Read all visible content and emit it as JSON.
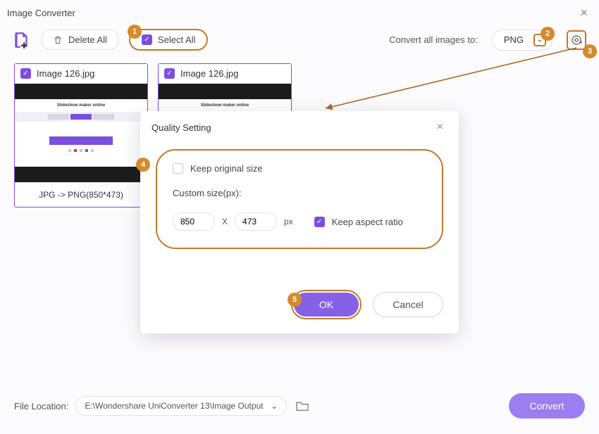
{
  "window": {
    "title": "Image Converter"
  },
  "toolbar": {
    "delete_all_label": "Delete All",
    "select_all_label": "Select All",
    "convert_to_label": "Convert all images to:",
    "format_value": "PNG"
  },
  "images": [
    {
      "name": "Image 126.jpg",
      "thumb_title": "Slideshow maker online",
      "conversion": "JPG -> PNG(850*473)"
    },
    {
      "name": "Image 126.jpg",
      "thumb_title": "Slideshow maker online",
      "conversion": ""
    }
  ],
  "dialog": {
    "title": "Quality Setting",
    "keep_original_label": "Keep original size",
    "custom_size_label": "Custom size(px):",
    "width": "850",
    "height": "473",
    "px_label": "px",
    "keep_aspect_label": "Keep aspect ratio",
    "ok_label": "OK",
    "cancel_label": "Cancel"
  },
  "badges": {
    "b1": "1",
    "b2": "2",
    "b3": "3",
    "b4": "4",
    "b5": "5"
  },
  "footer": {
    "file_location_label": "File Location:",
    "file_location_value": "E:\\Wondershare UniConverter 13\\Image Output",
    "convert_label": "Convert"
  }
}
